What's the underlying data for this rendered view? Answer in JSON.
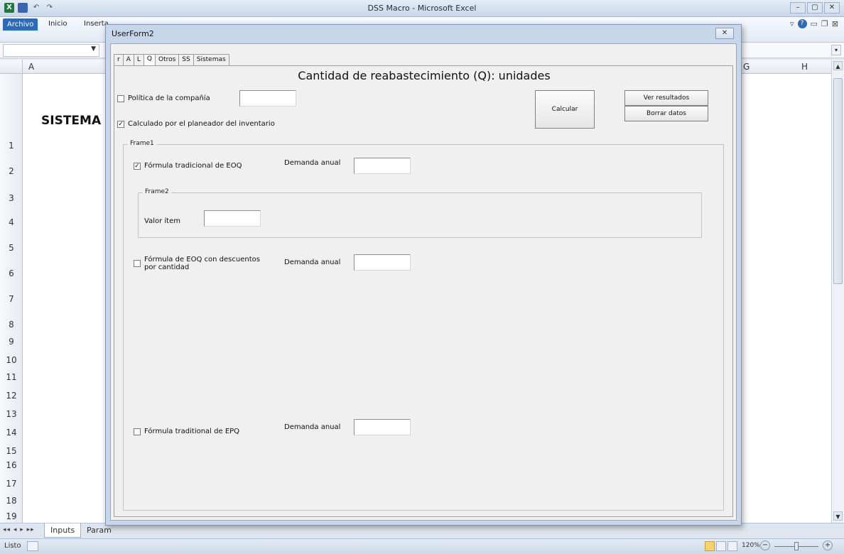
{
  "window": {
    "title": "DSS Macro - Microsoft Excel",
    "controls": [
      "–",
      "▢",
      "✕"
    ]
  },
  "ribbon": {
    "file_tab": "Archivo",
    "tab_inicio": "Inicio",
    "tab_insertar": "Inserta"
  },
  "sheet": {
    "columns": [
      "A",
      "G",
      "H"
    ],
    "rows": [
      "1",
      "2",
      "3",
      "4",
      "5",
      "6",
      "7",
      "8",
      "9",
      "10",
      "11",
      "12",
      "13",
      "14",
      "15",
      "16",
      "17",
      "18",
      "19"
    ],
    "title_text": "SISTEMA D"
  },
  "sheet_tabs": {
    "active": "Inputs",
    "next": "Param"
  },
  "status": {
    "ready": "Listo",
    "zoom": "120%"
  },
  "dialog": {
    "title": "UserForm2",
    "close": "✕",
    "tabs": [
      "r",
      "A",
      "L",
      "Q",
      "Otros",
      "SS",
      "Sistemas"
    ],
    "active_tab": "Q",
    "heading": "Cantidad de reabastecimiento (Q): unidades",
    "politica": {
      "label": "Política de la compañía",
      "checked": false,
      "value": ""
    },
    "calculado": {
      "label": "Calculado por el planeador del inventario",
      "checked": true
    },
    "buttons": {
      "calcular": "Calcular",
      "ver_resultados": "Ver resultados",
      "borrar_datos": "Borrar datos"
    },
    "frame1": {
      "label": "Frame1",
      "eoq_tradicional": {
        "label": "Fórmula tradicional de EOQ",
        "checked": true
      },
      "demanda1_label": "Demanda anual",
      "demanda1_value": "",
      "frame2": {
        "label": "Frame2",
        "valor_label": "Valor ítem",
        "valor_value": ""
      },
      "eoq_descuentos": {
        "label_line1": "Fórmula de EOQ con descuentos",
        "label_line2": "por cantidad",
        "checked": false
      },
      "demanda2_label": "Demanda anual",
      "demanda2_value": "",
      "epq": {
        "label": "Fórmula traditional de EPQ",
        "checked": false
      },
      "demanda3_label": "Demanda anual",
      "demanda3_value": ""
    }
  }
}
